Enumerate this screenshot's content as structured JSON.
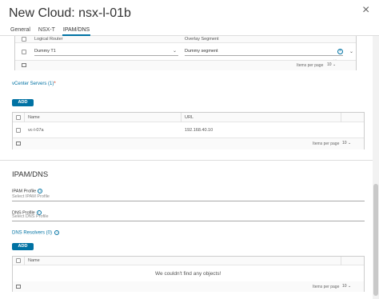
{
  "window": {
    "title": "New Cloud: nsx-l-01b",
    "close_label": "×"
  },
  "tabs": [
    {
      "label": "General",
      "active": false
    },
    {
      "label": "NSX-T",
      "active": false
    },
    {
      "label": "IPAM/DNS",
      "active": true
    }
  ],
  "segments_grid": {
    "columns": [
      "Logical Router",
      "Overlay Segment"
    ],
    "row": {
      "router": "Dummy T1",
      "segment": "Dummy segment"
    },
    "items_per_page_label": "Items per page",
    "items_per_page_value": "10"
  },
  "vcenter": {
    "title": "vCenter Servers (1)",
    "required_mark": "*",
    "add_label": "ADD",
    "columns": [
      "Name",
      "URL"
    ],
    "rows": [
      {
        "name": "vc-l-07a",
        "url": "192.168.40.10"
      }
    ],
    "items_per_page_label": "Items per page",
    "items_per_page_value": "10"
  },
  "ipam": {
    "section_title": "IPAM/DNS",
    "ipam_profile_label": "IPAM Profile",
    "ipam_profile_placeholder": "Select IPAM Profile",
    "dns_profile_label": "DNS Profile",
    "dns_profile_placeholder": "Select DNS Profile",
    "dns_resolvers_title": "DNS Resolvers (0)",
    "add_label": "ADD",
    "column_name": "Name",
    "empty_message": "We couldn't find any objects!",
    "items_per_page_label": "Items per page",
    "items_per_page_value": "10"
  },
  "colors": {
    "accent": "#0072a3",
    "required": "#c92100"
  }
}
